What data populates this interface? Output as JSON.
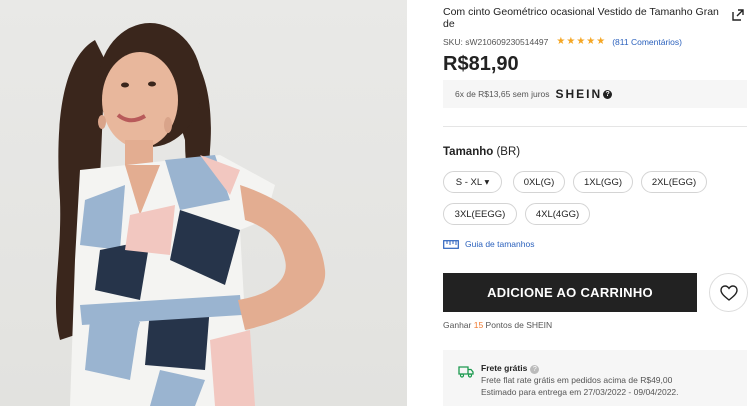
{
  "product": {
    "title": "Com cinto Geométrico ocasional Vestido de Tamanho Gran de",
    "sku": "SKU: sW2106092305144​97",
    "rating_stars": "★★★★★",
    "reviews": "(811 Comentários)",
    "price": "R$81,90"
  },
  "installment": {
    "text": "6x de R$13,65 sem juros",
    "brand": "SHEIN",
    "info_icon": "?"
  },
  "size": {
    "label": "Tamanho",
    "region": " (BR)",
    "selector": "S - XL ▾",
    "options": [
      "0XL(G)",
      "1XL(GG)",
      "2XL(EGG)",
      "3XL(EEGG)",
      "4XL(4GG)"
    ],
    "guide": "Guia de tamanhos"
  },
  "cart": {
    "button": "ADICIONE AO CARRINHO"
  },
  "points": {
    "prefix": "Ganhar ",
    "count": "15",
    "suffix": " Pontos de SHEIN"
  },
  "shipping": {
    "title": "Frete grátis",
    "info_icon": "?",
    "line1": "Frete flat rate grátis em pedidos acima de R$49,00",
    "line2": "Estimado para entrega em 27/03/2022 - 09/04/2022."
  },
  "colors": {
    "accent": "#222222",
    "link": "#2c62bd",
    "star": "#f5a623",
    "points": "#f0782d"
  },
  "icons": [
    "share-icon",
    "star-icon",
    "size-guide-icon",
    "heart-icon",
    "truck-icon"
  ]
}
